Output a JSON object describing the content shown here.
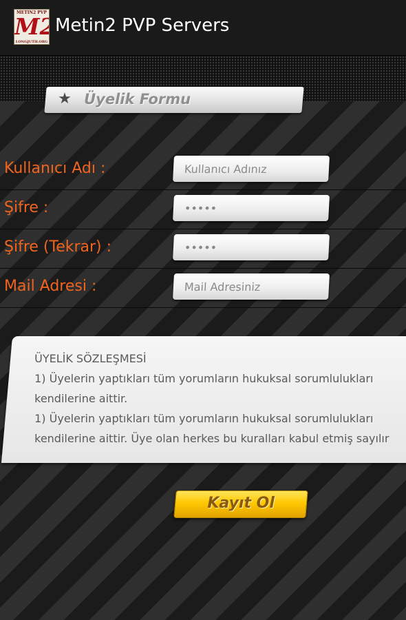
{
  "app_bar": {
    "title": "Metin2 PVP Servers",
    "icon": {
      "top_text": "METIN2 PVP",
      "letters": "M2",
      "bottom_text": "LONGJUTH.ORG"
    }
  },
  "section": {
    "title": "Üyelik Formu",
    "icon": "star-icon"
  },
  "form": {
    "fields": [
      {
        "label": "Kullanıcı Adı :",
        "placeholder": "Kullanıcı Adınız",
        "value": ""
      },
      {
        "label": "Şifre :",
        "placeholder": "",
        "value": "•••••"
      },
      {
        "label": "Şifre (Tekrar) :",
        "placeholder": "",
        "value": "•••••"
      },
      {
        "label": "Mail Adresi :",
        "placeholder": "Mail Adresiniz",
        "value": ""
      }
    ]
  },
  "agreement": {
    "title": "ÜYELİK SÖZLEŞMESİ",
    "lines": [
      "1) Üyelerin yaptıkları tüm yorumların hukuksal sorumlulukları kendilerine aittir.",
      "1) Üyelerin yaptıkları tüm yorumların hukuksal sorumlulukları kendilerine aittir. Üye olan herkes bu kuralları kabul etmiş sayılır"
    ]
  },
  "submit": {
    "label": "Kayıt Ol"
  },
  "colors": {
    "label_orange": "#f0641e",
    "button_yellow": "#ffc800",
    "app_bar": "#1a1a1a"
  }
}
